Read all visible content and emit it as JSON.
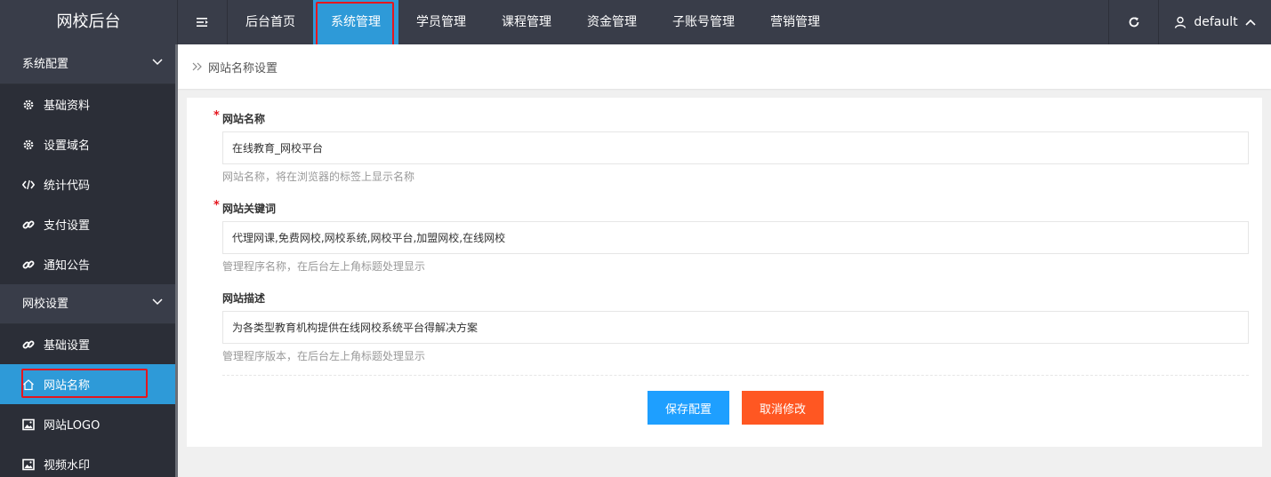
{
  "header": {
    "logo": "网校后台",
    "nav": [
      {
        "label": "后台首页"
      },
      {
        "label": "系统管理"
      },
      {
        "label": "学员管理"
      },
      {
        "label": "课程管理"
      },
      {
        "label": "资金管理"
      },
      {
        "label": "子账号管理"
      },
      {
        "label": "营销管理"
      }
    ],
    "user": "default"
  },
  "sidebar": {
    "groups": [
      {
        "title": "系统配置",
        "items": [
          {
            "label": "基础资料",
            "icon": "gear-icon"
          },
          {
            "label": "设置域名",
            "icon": "gear-icon"
          },
          {
            "label": "统计代码",
            "icon": "code-icon"
          },
          {
            "label": "支付设置",
            "icon": "link-icon"
          },
          {
            "label": "通知公告",
            "icon": "link-icon"
          }
        ]
      },
      {
        "title": "网校设置",
        "items": [
          {
            "label": "基础设置",
            "icon": "link-icon"
          },
          {
            "label": "网站名称",
            "icon": "home-icon"
          },
          {
            "label": "网站LOGO",
            "icon": "image-icon"
          },
          {
            "label": "视频水印",
            "icon": "image-icon"
          }
        ]
      }
    ]
  },
  "breadcrumb": "网站名称设置",
  "form": {
    "site_name": {
      "label": "网站名称",
      "value": "在线教育_网校平台",
      "hint": "网站名称，将在浏览器的标签上显示名称"
    },
    "keywords": {
      "label": "网站关键词",
      "value": "代理网课,免费网校,网校系统,网校平台,加盟网校,在线网校",
      "hint": "管理程序名称，在后台左上角标题处理显示"
    },
    "description": {
      "label": "网站描述",
      "value": "为各类型教育机构提供在线网校系统平台得解决方案",
      "hint": "管理程序版本，在后台左上角标题处理显示"
    },
    "save_label": "保存配置",
    "cancel_label": "取消修改"
  },
  "colors": {
    "dark": "#393d49",
    "accent": "#2e9ad8",
    "save": "#1e9fff",
    "cancel": "#ff5722",
    "highlight": "#e5161e"
  }
}
